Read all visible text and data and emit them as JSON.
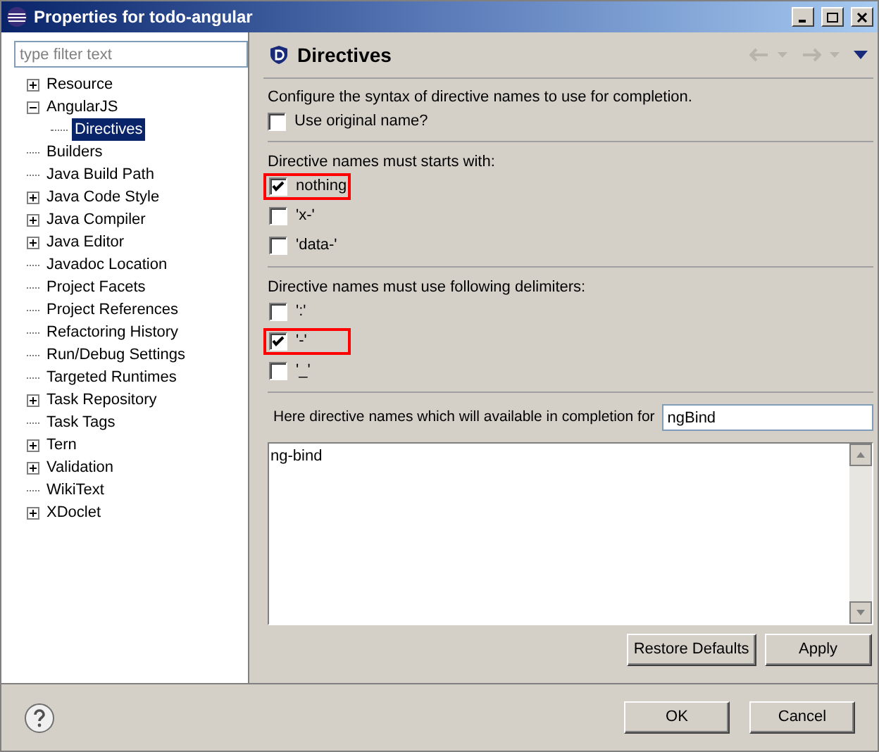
{
  "window": {
    "title": "Properties for todo-angular"
  },
  "filter": {
    "placeholder": "type filter text"
  },
  "tree": [
    {
      "kind": "group",
      "label": "Resource",
      "expanded": false
    },
    {
      "kind": "group",
      "label": "AngularJS",
      "expanded": true,
      "children": [
        {
          "label": "Directives",
          "selected": true
        }
      ]
    },
    {
      "kind": "leaf",
      "label": "Builders",
      "selected": false
    },
    {
      "kind": "leaf",
      "label": "Java Build Path",
      "selected": false
    },
    {
      "kind": "group",
      "label": "Java Code Style",
      "expanded": false
    },
    {
      "kind": "group",
      "label": "Java Compiler",
      "expanded": false
    },
    {
      "kind": "group",
      "label": "Java Editor",
      "expanded": false
    },
    {
      "kind": "leaf",
      "label": "Javadoc Location",
      "selected": false
    },
    {
      "kind": "leaf",
      "label": "Project Facets",
      "selected": false
    },
    {
      "kind": "leaf",
      "label": "Project References",
      "selected": false
    },
    {
      "kind": "leaf",
      "label": "Refactoring History",
      "selected": false
    },
    {
      "kind": "leaf",
      "label": "Run/Debug Settings",
      "selected": false
    },
    {
      "kind": "leaf",
      "label": "Targeted Runtimes",
      "selected": false
    },
    {
      "kind": "group",
      "label": "Task Repository",
      "expanded": false
    },
    {
      "kind": "leaf",
      "label": "Task Tags",
      "selected": false
    },
    {
      "kind": "group",
      "label": "Tern",
      "expanded": false
    },
    {
      "kind": "group",
      "label": "Validation",
      "expanded": false
    },
    {
      "kind": "leaf",
      "label": "WikiText",
      "selected": false
    },
    {
      "kind": "group",
      "label": "XDoclet",
      "expanded": false
    }
  ],
  "page": {
    "title": "Directives",
    "description": "Configure the syntax of directive names to use for completion.",
    "use_original": {
      "label": "Use original name?",
      "checked": false
    },
    "sections": [
      {
        "heading": "Directive names must starts with:",
        "options": [
          {
            "label": "nothing",
            "checked": true,
            "highlighted": true
          },
          {
            "label": "'x-'",
            "checked": false,
            "highlighted": false
          },
          {
            "label": "'data-'",
            "checked": false,
            "highlighted": false
          }
        ]
      },
      {
        "heading": "Directive names must use following delimiters:",
        "options": [
          {
            "label": "':'",
            "checked": false,
            "highlighted": false
          },
          {
            "label": "'-'",
            "checked": true,
            "highlighted": true
          },
          {
            "label": "'_'",
            "checked": false,
            "highlighted": false
          }
        ]
      }
    ],
    "completion_label": "Here directive names which will available in completion for",
    "completion_value": "ngBind",
    "result_text": "ng-bind",
    "buttons": [
      "Restore Defaults",
      "Apply"
    ]
  },
  "dialog_buttons": [
    "OK",
    "Cancel"
  ]
}
